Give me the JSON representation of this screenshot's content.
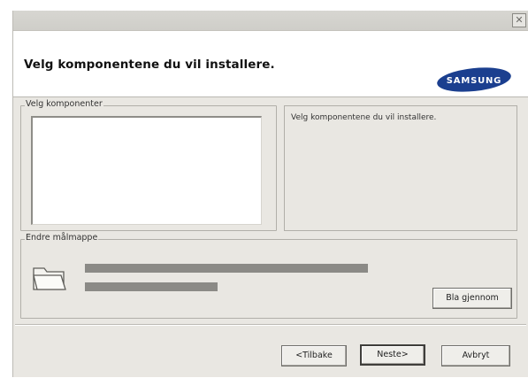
{
  "window": {
    "close_symbol": "✕"
  },
  "header": {
    "title": "Velg komponentene du vil installere.",
    "logo_text": "SAMSUNG"
  },
  "components_group": {
    "label": "Velg komponenter",
    "items": []
  },
  "description": {
    "text": "Velg komponentene du vil installere."
  },
  "destination_group": {
    "label": "Endre målmappe",
    "browse_label": "Bla gjennom",
    "folder_icon": "folder-icon"
  },
  "footer": {
    "back_label": "<Tilbake",
    "next_label": "Neste>",
    "cancel_label": "Avbryt"
  },
  "colors": {
    "window_bg": "#e9e7e2",
    "header_bg": "#ffffff",
    "logo_blue": "#1b3f8f"
  }
}
